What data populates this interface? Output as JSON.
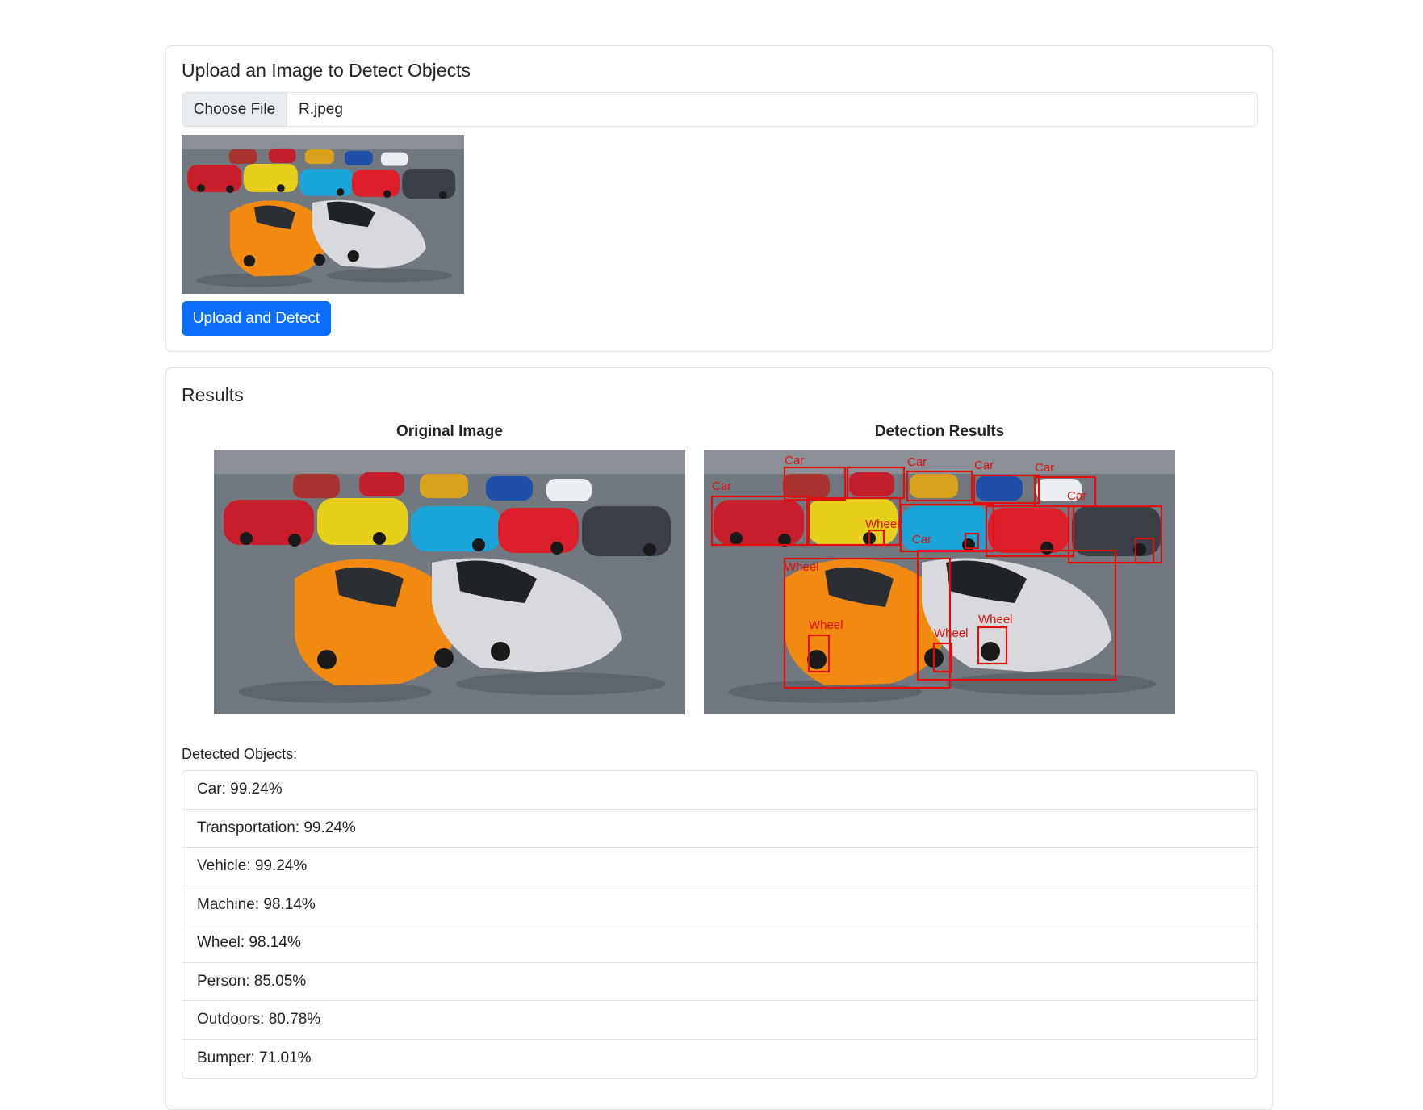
{
  "upload": {
    "title": "Upload an Image to Detect Objects",
    "choose_file_label": "Choose File",
    "file_name": "R.jpeg",
    "button_label": "Upload and Detect"
  },
  "results": {
    "title": "Results",
    "original_caption": "Original Image",
    "detection_caption": "Detection Results",
    "box_labels": {
      "car": "Car",
      "wheel": "Wheel"
    },
    "objects_label": "Detected Objects:",
    "objects": [
      "Car: 99.24%",
      "Transportation: 99.24%",
      "Vehicle: 99.24%",
      "Machine: 98.14%",
      "Wheel: 98.14%",
      "Person: 85.05%",
      "Outdoors: 80.78%",
      "Bumper: 71.01%"
    ]
  },
  "colors": {
    "primary": "#0d6efd",
    "border": "#dee2e6",
    "detection_box": "#e01010",
    "car_orange": "#f28a12",
    "car_silver": "#d7d9dc",
    "car_red": "#c81d2a",
    "car_yellow": "#e7cf1c",
    "car_blue": "#1aa4d8",
    "car_darkgray": "#3b3f47",
    "ground": "#6d737a"
  }
}
